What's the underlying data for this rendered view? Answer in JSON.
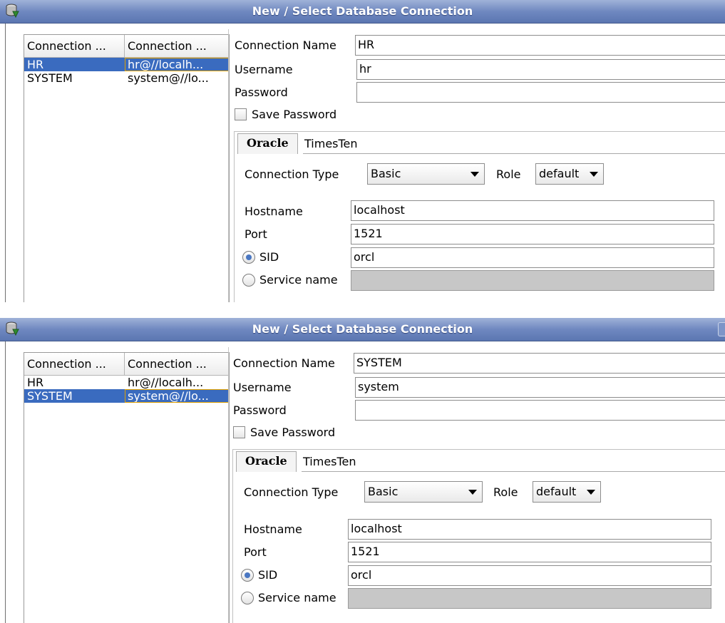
{
  "screens": [
    {
      "title": "New / Select Database Connection",
      "list": {
        "headers": [
          "Connection ...",
          "Connection ..."
        ],
        "rows": [
          {
            "name": "HR",
            "details": "hr@//localh...",
            "selected": true
          },
          {
            "name": "SYSTEM",
            "details": "system@//lo...",
            "selected": false
          }
        ]
      },
      "form": {
        "connection_name_label": "Connection Name",
        "connection_name_value": "HR",
        "username_label": "Username",
        "username_value": "hr",
        "password_label": "Password",
        "password_value": "",
        "save_password_label": "Save Password",
        "save_password_checked": false
      },
      "tabs": [
        "Oracle",
        "TimesTen"
      ],
      "active_tab": "Oracle",
      "oracle": {
        "connection_type_label": "Connection Type",
        "connection_type_value": "Basic",
        "role_label": "Role",
        "role_value": "default",
        "hostname_label": "Hostname",
        "hostname_value": "localhost",
        "port_label": "Port",
        "port_value": "1521",
        "sid_label": "SID",
        "sid_value": "orcl",
        "sid_selected": true,
        "service_name_label": "Service name",
        "service_name_value": ""
      }
    },
    {
      "title": "New / Select Database Connection",
      "list": {
        "headers": [
          "Connection ...",
          "Connection ..."
        ],
        "rows": [
          {
            "name": "HR",
            "details": "hr@//localh...",
            "selected": false
          },
          {
            "name": "SYSTEM",
            "details": "system@//lo...",
            "selected": true
          }
        ]
      },
      "form": {
        "connection_name_label": "Connection Name",
        "connection_name_value": "SYSTEM",
        "username_label": "Username",
        "username_value": "system",
        "password_label": "Password",
        "password_value": "",
        "save_password_label": "Save Password",
        "save_password_checked": false
      },
      "tabs": [
        "Oracle",
        "TimesTen"
      ],
      "active_tab": "Oracle",
      "oracle": {
        "connection_type_label": "Connection Type",
        "connection_type_value": "Basic",
        "role_label": "Role",
        "role_value": "default",
        "hostname_label": "Hostname",
        "hostname_value": "localhost",
        "port_label": "Port",
        "port_value": "1521",
        "sid_label": "SID",
        "sid_value": "orcl",
        "sid_selected": true,
        "service_name_label": "Service name",
        "service_name_value": ""
      }
    }
  ],
  "icons": {
    "app_icon": "database-connection-icon",
    "dropdown_arrow": "chevron-down-icon"
  },
  "colors": {
    "titlebar": "#6f88c0",
    "selection": "#3a6bbf",
    "focus_outline": "#e0a000",
    "disabled_field": "#c7c7c7",
    "radio_dot": "#4a77c2"
  }
}
